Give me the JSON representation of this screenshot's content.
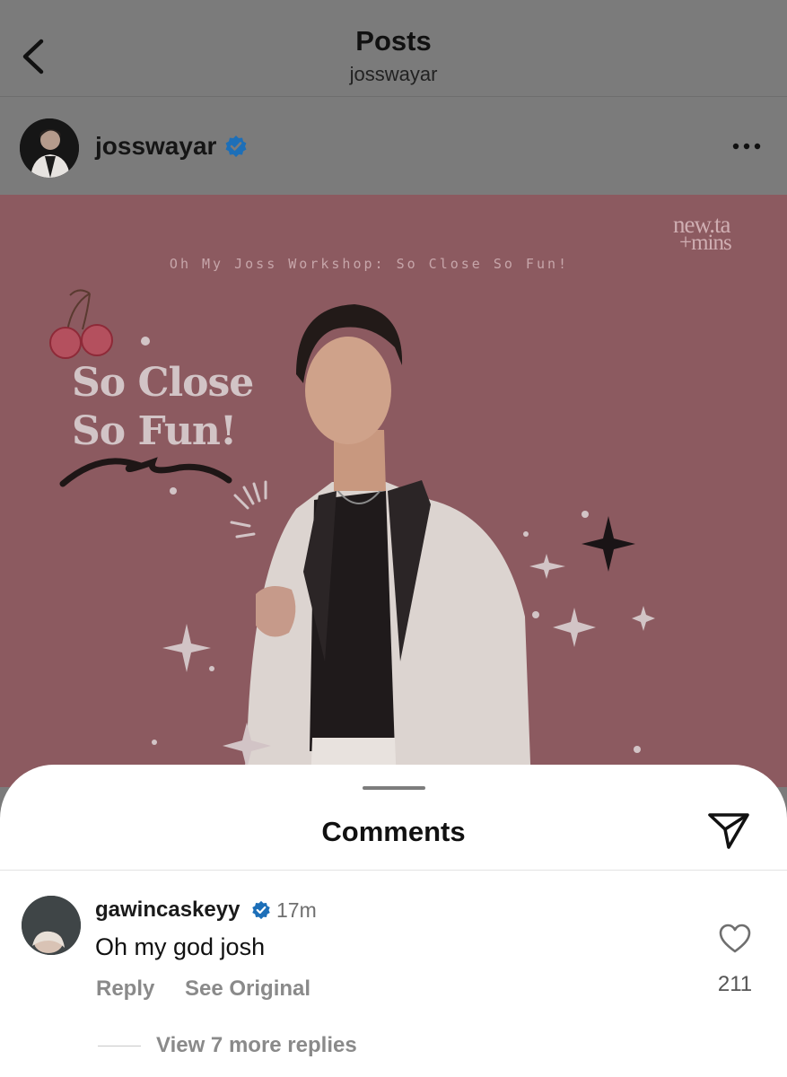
{
  "header": {
    "title": "Posts",
    "subtitle": "josswayar"
  },
  "post": {
    "username": "josswayar",
    "verified": true,
    "image": {
      "subtitle": "Oh My Joss Workshop: So Close So Fun!",
      "logo_line1": "new.ta",
      "logo_line2": "+mins",
      "title_line1": "So Close",
      "title_line2": "So Fun!",
      "background_color": "#8c5a60"
    }
  },
  "comments_sheet": {
    "title": "Comments",
    "comments": [
      {
        "username": "gawincaskeyy",
        "verified": true,
        "time": "17m",
        "text": "Oh my god josh",
        "reply_label": "Reply",
        "see_original_label": "See Original",
        "likes": "211",
        "view_replies_label": "View 7 more replies"
      }
    ]
  },
  "icons": {
    "back": "chevron-left-icon",
    "more": "more-horizontal-icon",
    "verified": "verified-badge-icon",
    "share": "paper-plane-icon",
    "like": "heart-outline-icon"
  },
  "colors": {
    "verified_blue": "#1d6fb8",
    "dim_overlay": "#7b7b7b",
    "secondary_text": "#8a8a8a"
  }
}
